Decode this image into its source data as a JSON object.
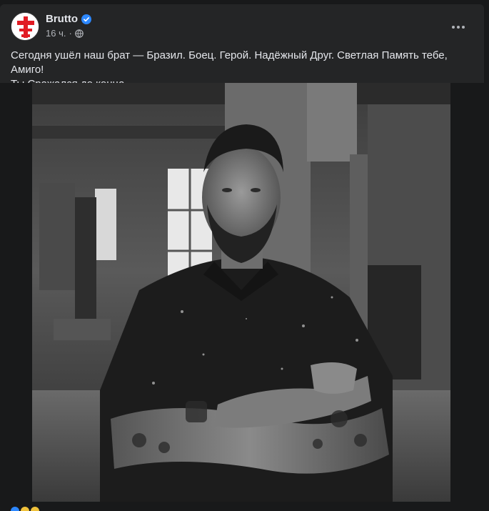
{
  "post": {
    "author": "Brutto",
    "time": "16 ч.",
    "separator": "·",
    "text_line1": "Сегодня ушёл наш брат — Бразил. Боец. Герой. Надёжный Друг. Светлая Память тебе, Амиго!",
    "text_line2": "Ты Сражался до конца.",
    "icons": {
      "verified": "verified-badge-icon",
      "audience": "globe-icon",
      "more": "more-options-icon"
    },
    "colors": {
      "background": "#18191a",
      "card": "#242526",
      "primary_text": "#e4e6eb",
      "secondary_text": "#b0b3b8",
      "verified": "#2d88ff",
      "logo_red": "#e11c24"
    }
  }
}
